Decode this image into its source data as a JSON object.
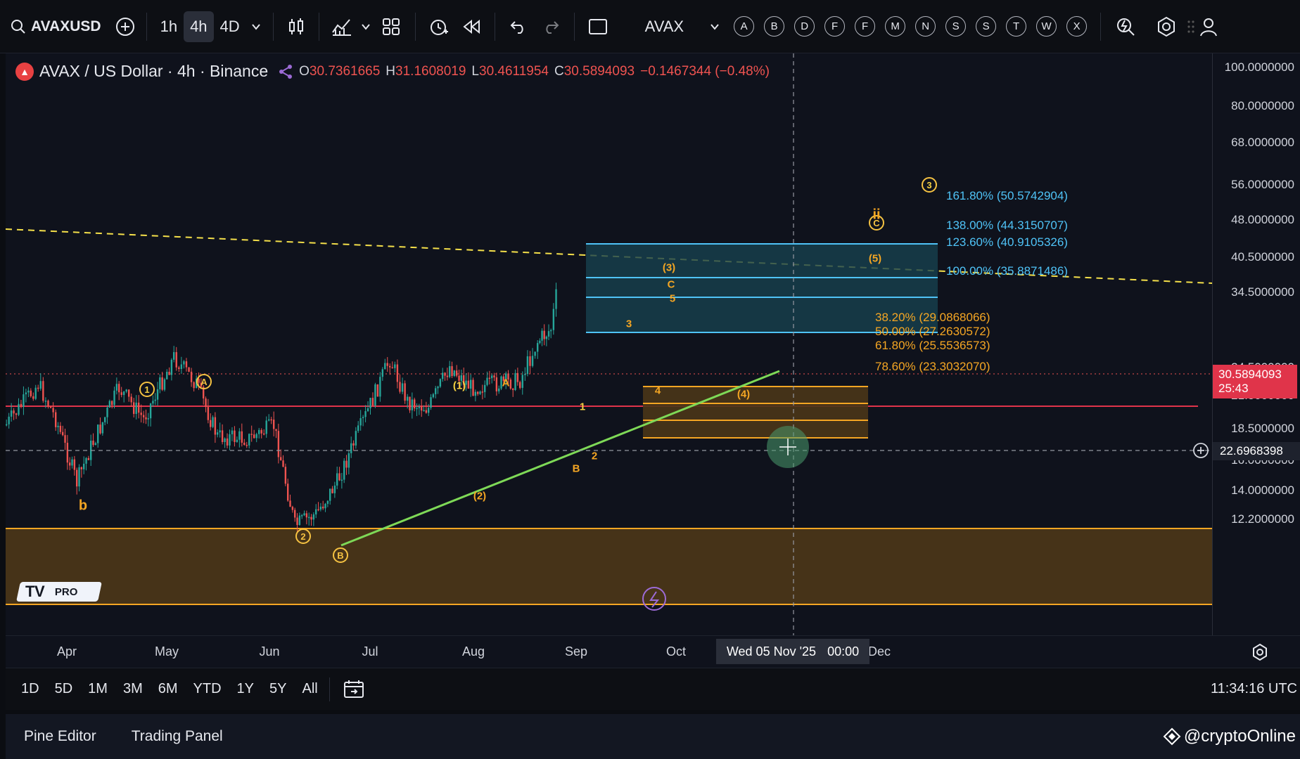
{
  "toolbar": {
    "symbol": "AVAXUSD",
    "intervals": [
      "1h",
      "4h",
      "4D"
    ],
    "active_interval": "4h",
    "watch_label": "AVAX",
    "letters": [
      "A",
      "B",
      "D",
      "F",
      "F",
      "M",
      "N",
      "S",
      "S",
      "T",
      "W",
      "X"
    ]
  },
  "legend": {
    "title": "AVAX / US Dollar · 4h · Binance",
    "open_k": "O",
    "open": "30.7361665",
    "high_k": "H",
    "high": "31.1608019",
    "low_k": "L",
    "low": "30.4611954",
    "close_k": "C",
    "close": "30.5894093",
    "change": "−0.1467344 (−0.48%)"
  },
  "price_scale": {
    "labels": [
      "100.0000000",
      "80.0000000",
      "68.0000000",
      "56.0000000",
      "48.0000000",
      "40.5000000",
      "34.5000000",
      "24.5000000",
      "21.5000000",
      "18.5000000",
      "16.0000000",
      "14.0000000",
      "12.2000000"
    ],
    "last_price": "30.5894093",
    "countdown": "25:43",
    "crosshair_price": "22.6968398"
  },
  "time_scale": {
    "labels": [
      "Apr",
      "May",
      "Jun",
      "Jul",
      "Aug",
      "Sep",
      "Oct",
      "Dec"
    ],
    "crosshair_date": "Wed 05 Nov '25",
    "crosshair_time": "00:00"
  },
  "fib_upper": [
    {
      "label": "161.80% (50.5742904)"
    },
    {
      "label": "138.00% (44.3150707)"
    },
    {
      "label": "123.60% (40.9105326)"
    },
    {
      "label": "100.00% (35.8871486)"
    }
  ],
  "fib_lower": [
    {
      "label": "38.20% (29.0868066)"
    },
    {
      "label": "50.00% (27.2630572)"
    },
    {
      "label": "61.80% (25.5536573)"
    },
    {
      "label": "78.60% (23.3032070)"
    }
  ],
  "waves": {
    "circ1": "1",
    "circA": "A",
    "circ2": "2",
    "circB": "B",
    "circC": "C",
    "circ3": "3",
    "b": "b",
    "p1": "(1)",
    "A": "A",
    "p2": "(2)",
    "B": "B",
    "n1": "1",
    "n2": "2",
    "n3": "3",
    "n4": "4",
    "n5": "5",
    "C": "C",
    "p3": "(3)",
    "p4": "(4)",
    "p5": "(5)",
    "ii": "ii"
  },
  "range_bar": {
    "ranges": [
      "1D",
      "5D",
      "1M",
      "3M",
      "6M",
      "YTD",
      "1Y",
      "5Y",
      "All"
    ],
    "clock": "11:34:16 UTC"
  },
  "bottom_panel": {
    "tabs": [
      "Pine Editor",
      "Trading Panel"
    ],
    "watermark": "@cryptoOnline"
  },
  "logo": {
    "text": "PRO"
  },
  "colors": {
    "bg": "#0f121c",
    "up": "#26a69a",
    "down": "#ef5350",
    "fib_upper": "#4fc3f7",
    "fib_lower": "#f5a623",
    "trendline": "#7ed957",
    "wave": "#f5a623"
  }
}
